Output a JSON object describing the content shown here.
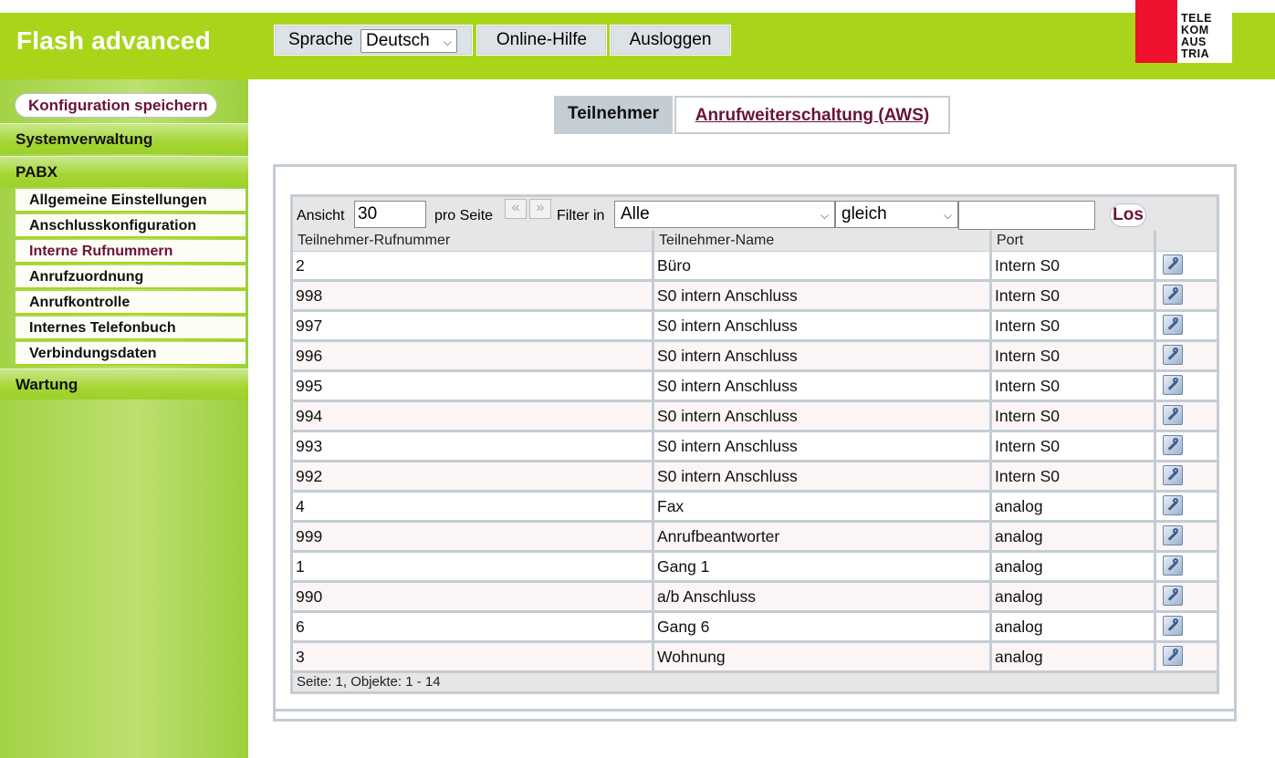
{
  "header": {
    "app_title": "Flash advanced",
    "language_label": "Sprache",
    "language_value": "Deutsch",
    "help_label": "Online-Hilfe",
    "logout_label": "Ausloggen",
    "logo_lines": [
      "TELE",
      "KOM",
      "AUS",
      "TRIA"
    ]
  },
  "sidebar": {
    "save_config": "Konfiguration speichern",
    "sections": [
      {
        "label": "Systemverwaltung"
      },
      {
        "label": "PABX"
      },
      {
        "label": "Wartung"
      }
    ],
    "pabx_items": [
      {
        "label": "Allgemeine Einstellungen"
      },
      {
        "label": "Anschlusskonfiguration"
      },
      {
        "label": "Interne Rufnummern"
      },
      {
        "label": "Anrufzuordnung"
      },
      {
        "label": "Anrufkontrolle"
      },
      {
        "label": "Internes Telefonbuch"
      },
      {
        "label": "Verbindungsdaten"
      }
    ]
  },
  "tabs": [
    {
      "label": "Teilnehmer"
    },
    {
      "label": "Anrufweiterschaltung (AWS)"
    }
  ],
  "toolbar": {
    "view_label": "Ansicht",
    "view_value": "30",
    "per_page_label": "pro Seite",
    "prev_glyph": "«",
    "next_glyph": "»",
    "filter_label": "Filter in",
    "filter_field": "Alle",
    "filter_op": "gleich",
    "filter_value": "",
    "go_label": "Los"
  },
  "table": {
    "columns": [
      "Teilnehmer-Rufnummer",
      "Teilnehmer-Name",
      "Port",
      ""
    ],
    "rows": [
      {
        "number": "2",
        "name": "Büro",
        "port": "Intern S0"
      },
      {
        "number": "998",
        "name": "S0 intern Anschluss",
        "port": "Intern S0"
      },
      {
        "number": "997",
        "name": "S0 intern Anschluss",
        "port": "Intern S0"
      },
      {
        "number": "996",
        "name": "S0 intern Anschluss",
        "port": "Intern S0"
      },
      {
        "number": "995",
        "name": "S0 intern Anschluss",
        "port": "Intern S0"
      },
      {
        "number": "994",
        "name": "S0 intern Anschluss",
        "port": "Intern S0"
      },
      {
        "number": "993",
        "name": "S0 intern Anschluss",
        "port": "Intern S0"
      },
      {
        "number": "992",
        "name": "S0 intern Anschluss",
        "port": "Intern S0"
      },
      {
        "number": "4",
        "name": "Fax",
        "port": "analog"
      },
      {
        "number": "999",
        "name": "Anrufbeantworter",
        "port": "analog"
      },
      {
        "number": "1",
        "name": "Gang 1",
        "port": "analog"
      },
      {
        "number": "990",
        "name": "a/b Anschluss",
        "port": "analog"
      },
      {
        "number": "6",
        "name": "Gang 6",
        "port": "analog"
      },
      {
        "number": "3",
        "name": "Wohnung",
        "port": "analog"
      }
    ],
    "footer": "Seite:  1, Objekte:  1 - 14"
  },
  "colors": {
    "brand_green": "#a8d51a",
    "accent_maroon": "#6b1238",
    "logo_red": "#f0112f"
  }
}
